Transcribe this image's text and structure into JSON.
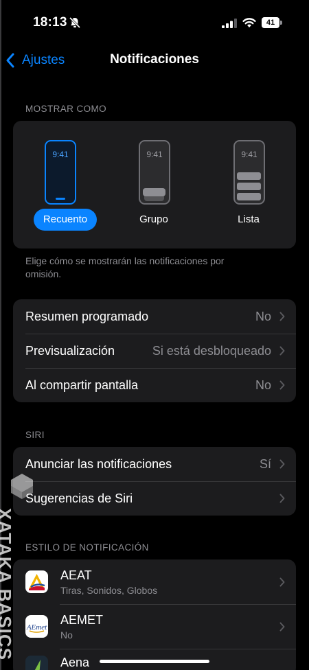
{
  "status_bar": {
    "time": "18:13",
    "battery": "41"
  },
  "nav": {
    "back_label": "Ajustes",
    "title": "Notificaciones"
  },
  "display_as": {
    "header": "MOSTRAR COMO",
    "options": [
      {
        "label": "Recuento",
        "phone_time": "9:41",
        "selected": true
      },
      {
        "label": "Grupo",
        "phone_time": "9:41",
        "selected": false
      },
      {
        "label": "Lista",
        "phone_time": "9:41",
        "selected": false
      }
    ],
    "footer": "Elige cómo se mostrarán las notificaciones por omisión."
  },
  "general_settings": [
    {
      "label": "Resumen programado",
      "value": "No"
    },
    {
      "label": "Previsualización",
      "value": "Si está desbloqueado"
    },
    {
      "label": "Al compartir pantalla",
      "value": "No"
    }
  ],
  "siri": {
    "header": "SIRI",
    "rows": [
      {
        "label": "Anunciar las notificaciones",
        "value": "Sí"
      },
      {
        "label": "Sugerencias de Siri",
        "value": ""
      }
    ]
  },
  "notification_style": {
    "header": "ESTILO DE NOTIFICACIÓN",
    "apps": [
      {
        "name": "AEAT",
        "subtitle": "Tiras, Sonidos, Globos",
        "icon": "aeat-logo-icon"
      },
      {
        "name": "AEMET",
        "subtitle": "No",
        "icon": "aemet-logo-icon",
        "logo_text": "AEmet"
      },
      {
        "name": "Aena",
        "subtitle": "",
        "icon": "aena-logo-icon"
      }
    ]
  },
  "watermark": {
    "text": "XATAKA BASICS"
  },
  "colors": {
    "accent": "#0a84ff",
    "card": "#1c1c1e",
    "secondary_text": "#8e8e93"
  }
}
